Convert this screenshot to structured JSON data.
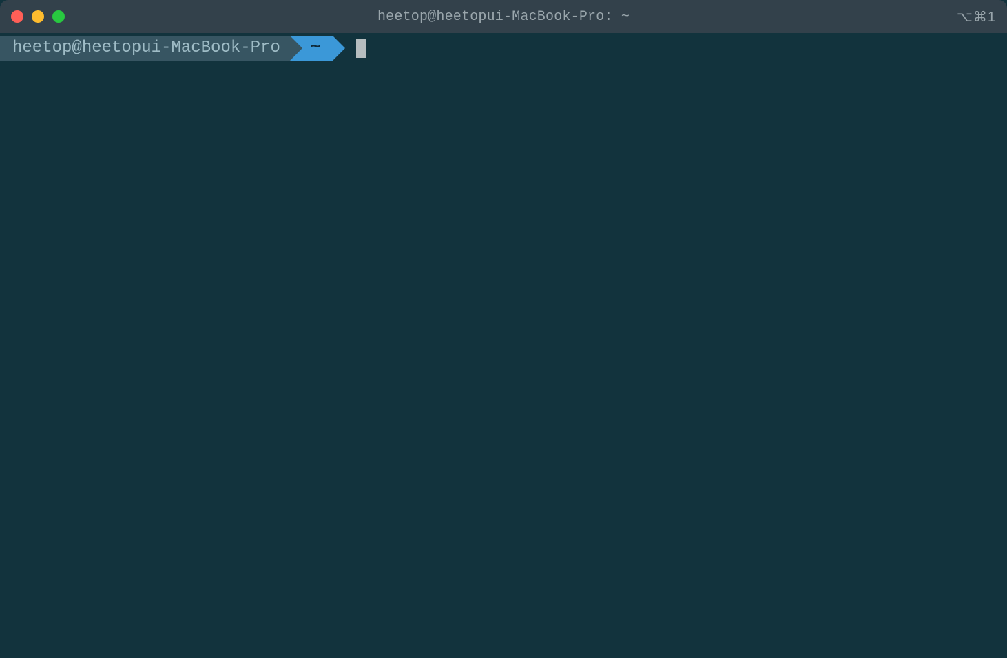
{
  "titlebar": {
    "title": "heetop@heetopui-MacBook-Pro: ~",
    "shortcut": "⌥⌘1"
  },
  "prompt": {
    "user_host": "heetop@heetopui-MacBook-Pro",
    "path": "~",
    "command": ""
  },
  "colors": {
    "bg": "#12333d",
    "titlebar_bg": "#33414b",
    "titlebar_fg": "#9aa6ac",
    "segment_host_bg": "#375562",
    "segment_host_fg": "#9fbcc6",
    "segment_path_bg": "#3b98d8",
    "segment_path_fg": "#0f2a3a",
    "cursor": "#b6bdbf",
    "traffic_red": "#ff5f57",
    "traffic_yellow": "#febc2e",
    "traffic_green": "#28c840"
  }
}
